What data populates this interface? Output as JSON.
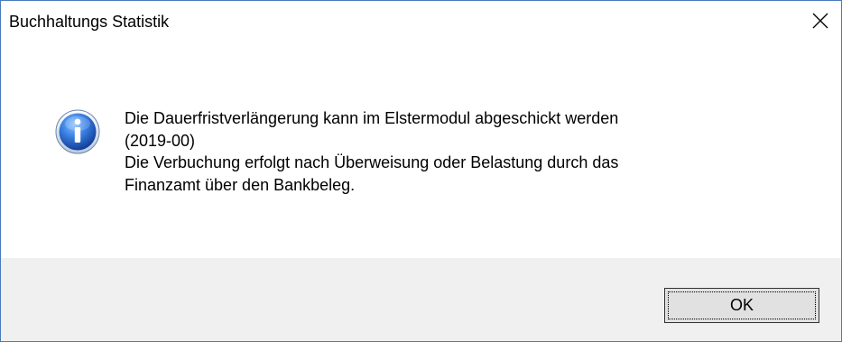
{
  "window": {
    "title": "Buchhaltungs Statistik",
    "close_icon": "close-icon"
  },
  "message": {
    "icon": "info-icon",
    "lines": [
      "Die Dauerfristverlängerung kann im Elstermodul abgeschickt werden",
      "(2019-00)",
      "Die Verbuchung erfolgt nach Überweisung oder Belastung durch das",
      "Finanzamt über den Bankbeleg."
    ]
  },
  "buttons": {
    "ok_label": "OK"
  },
  "colors": {
    "footer_bg": "#f0f0f0",
    "button_bg": "#e1e1e1",
    "window_border": "#4a7ab8",
    "icon_blue": "#1f5fbf"
  }
}
